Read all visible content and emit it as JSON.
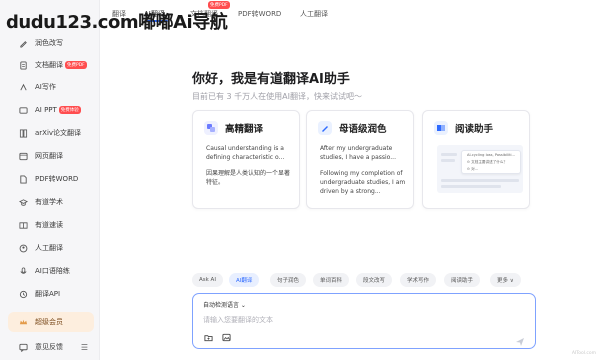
{
  "watermark": {
    "text": "dudu123.com嘟嘟Ai导航"
  },
  "sidebar": {
    "items": [
      {
        "label": "润色改写",
        "icon": "pen-polish-icon"
      },
      {
        "label": "文档翻译",
        "icon": "document-icon",
        "tag": "免费PDF"
      },
      {
        "label": "AI写作",
        "icon": "ai-write-icon"
      },
      {
        "label": "AI PPT",
        "icon": "ppt-icon",
        "tag": "免费体验"
      },
      {
        "label": "arXiv论文翻译",
        "icon": "paper-icon"
      },
      {
        "label": "网页翻译",
        "icon": "web-icon"
      },
      {
        "label": "PDF转WORD",
        "icon": "pdf-icon"
      },
      {
        "label": "有道学术",
        "icon": "academic-icon"
      },
      {
        "label": "有道速读",
        "icon": "speed-read-icon"
      },
      {
        "label": "人工翻译",
        "icon": "human-translate-icon"
      },
      {
        "label": "AI口语陪练",
        "icon": "speech-icon"
      },
      {
        "label": "翻译API",
        "icon": "api-icon"
      }
    ],
    "vip": {
      "label": "超级会员"
    },
    "feedback": {
      "label": "意见反馈"
    }
  },
  "topbar": {
    "tabs": [
      {
        "label": "翻译"
      },
      {
        "label": "AI翻译"
      },
      {
        "label": "文档翻译",
        "tag": "免费PDF"
      },
      {
        "label": "PDF转WORD"
      },
      {
        "label": "人工翻译"
      }
    ]
  },
  "hero": {
    "title": "你好，我是有道翻译AI助手",
    "subtitle": "目前已有 3 千万人在使用AI翻译，快来试试吧～"
  },
  "cards": [
    {
      "title": "高精翻译",
      "text_en": "Causal understanding is a defining characteristic o...",
      "text_zh": "因果理解是人类认知的一个显著特征。"
    },
    {
      "title": "母语级润色",
      "text_en": "After my undergraduate studies, I have a passio...",
      "text_en2": "Following my completion of undergraduate studies, I am driven by a strong..."
    },
    {
      "title": "阅读助手",
      "mini_rows": [
        "AI-cycling loss, Possibiliti...",
        "⊙ 文档主要讲述了什么？",
        "⊙ 对..."
      ]
    }
  ],
  "chips": [
    {
      "label": "Ask AI"
    },
    {
      "label": "AI翻译"
    },
    {
      "label": "句子润色"
    },
    {
      "label": "单词百科"
    },
    {
      "label": "段文改写"
    },
    {
      "label": "学术写作"
    },
    {
      "label": "阅读助手"
    },
    {
      "label": "更多 ∨"
    }
  ],
  "input": {
    "language": "自动检测语言 ⌄",
    "placeholder": "请输入您要翻译的文本"
  },
  "footer": {
    "mark": "AITool.com"
  },
  "colors": {
    "accent": "#2f6bff",
    "vip_bg": "#fdeede",
    "tag_red": "#ff4d4f"
  }
}
